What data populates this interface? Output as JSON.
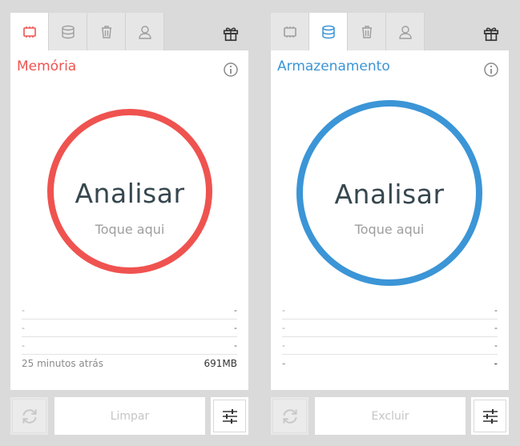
{
  "colors": {
    "memory_accent": "#ef5350",
    "storage_accent": "#3b95d6"
  },
  "tabs": [
    {
      "icon": "chip-icon"
    },
    {
      "icon": "database-icon"
    },
    {
      "icon": "trash-icon"
    },
    {
      "icon": "user-icon"
    }
  ],
  "left_panel": {
    "title": "Memória",
    "active_tab": 0,
    "ring_label": "Analisar",
    "ring_sub": "Toque aqui",
    "rows": [
      {
        "left": "-",
        "right": "-"
      },
      {
        "left": "-",
        "right": "-"
      },
      {
        "left": "-",
        "right": "-"
      },
      {
        "left": "25 minutos atrás",
        "right": "691MB"
      }
    ],
    "action_label": "Limpar"
  },
  "right_panel": {
    "title": "Armazenamento",
    "active_tab": 1,
    "ring_label": "Analisar",
    "ring_sub": "Toque aqui",
    "rows": [
      {
        "left": "-",
        "right": "-"
      },
      {
        "left": "-",
        "right": "-"
      },
      {
        "left": "-",
        "right": "-"
      },
      {
        "left": "-",
        "right": "-"
      }
    ],
    "action_label": "Excluir"
  }
}
